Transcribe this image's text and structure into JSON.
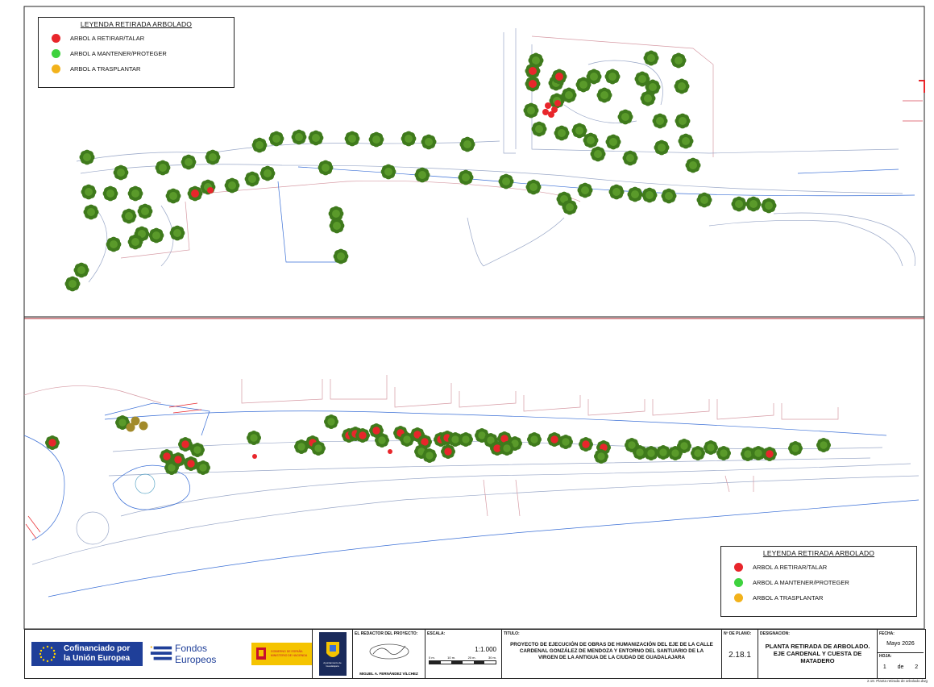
{
  "legend": {
    "title": "LEYENDA RETIRADA ARBOLADO",
    "items": [
      {
        "label": "ARBOL A RETIRAR/TALAR",
        "color": "#e8262b"
      },
      {
        "label": "ARBOL A MANTENER/PROTEGER",
        "color": "#3ed23e"
      },
      {
        "label": "ARBOL A TRASPLANTAR",
        "color": "#f2b21b"
      }
    ]
  },
  "titleblock": {
    "eu_line1": "Cofinanciado por",
    "eu_line2": "la Unión Europea",
    "fondos": "Fondos Europeos",
    "gob_line1": "GOBIERNO DE ESPAÑA",
    "gob_line2": "MINISTERIO DE HACIENDA",
    "ayto": "Ayuntamiento de Guadalajara",
    "redactor_label": "EL REDACTOR DEL PROYECTO:",
    "redactor_name": "MIGUEL A. FERNÁNDEZ VÍLCHEZ",
    "escala_label": "ESCALA:",
    "escala_value": "1:1.000",
    "scale_ticks": [
      "0 m.",
      "10 m.",
      "20 m.",
      "30 m."
    ],
    "titulo_label": "TITULO:",
    "titulo_value": "PROYECTO DE EJECUCIÓN DE OBRAS DE HUMANIZACIÓN DEL EJE DE LA CALLE CARDENAL GONZÁLEZ DE MENDOZA Y ENTORNO DEL SANTUARIO DE LA VIRGEN DE LA ANTIGUA DE LA CIUDAD DE GUADALAJARA",
    "plano_label": "Nº DE PLANO:",
    "plano_value": "2.18.1",
    "designacion_label": "DESIGNACION:",
    "designacion_value": "PLANTA RETIRADA DE ARBOLADO. EJE CARDENAL Y CUESTA DE MATADERO",
    "fecha_label": "FECHA:",
    "fecha_value": "Mayo 2026",
    "hoja_label": "HOJA:",
    "hoja_num": "1",
    "hoja_de": "de",
    "hoja_total": "2",
    "file_note": "2.18. Planta retirada de arbolado.dwg"
  },
  "colors": {
    "red": "#e8262b",
    "green": "#3ed23e",
    "orange": "#f2b21b",
    "tree": "#3f7a1c"
  }
}
